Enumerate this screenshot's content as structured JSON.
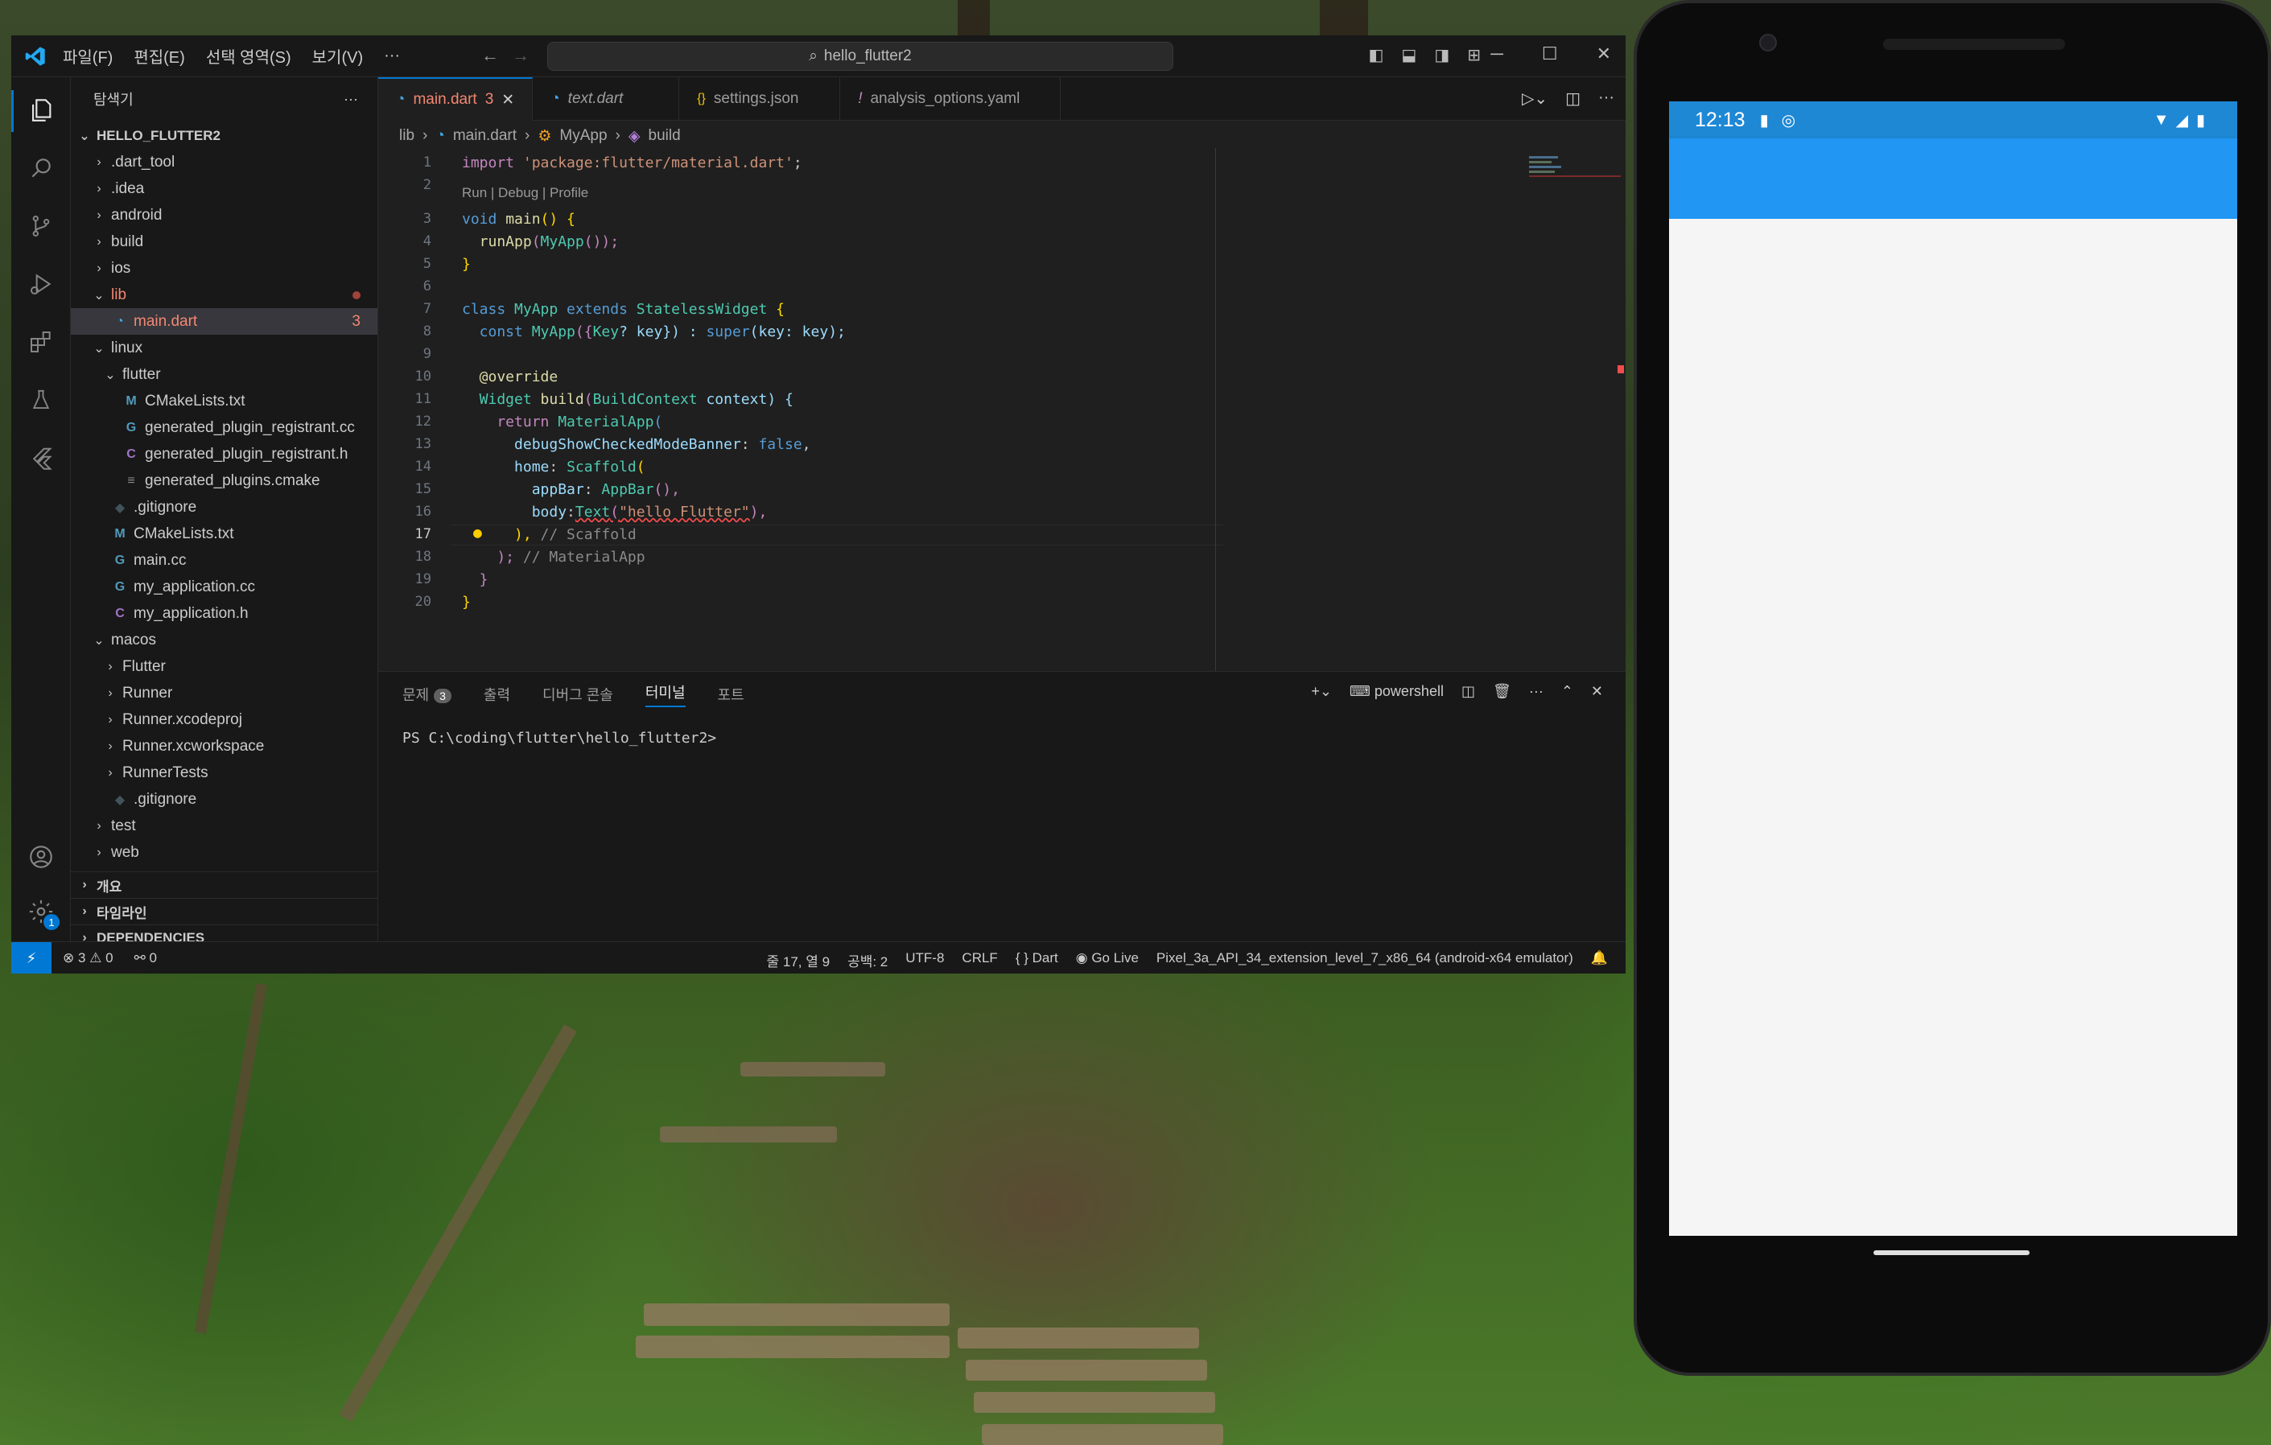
{
  "titlebar": {
    "menu": [
      "파일(F)",
      "편집(E)",
      "선택 영역(S)",
      "보기(V)",
      "···"
    ],
    "search": "hello_flutter2"
  },
  "sidebar": {
    "title": "탐색기",
    "more": "···",
    "root": "HELLO_FLUTTER2",
    "items": [
      {
        "label": ".dart_tool",
        "chev": "›",
        "icon": ""
      },
      {
        "label": ".idea",
        "chev": "›",
        "icon": ""
      },
      {
        "label": "android",
        "chev": "›",
        "icon": ""
      },
      {
        "label": "build",
        "chev": "›",
        "icon": ""
      },
      {
        "label": "ios",
        "chev": "›",
        "icon": ""
      },
      {
        "label": "lib",
        "chev": "⌄",
        "icon": ""
      },
      {
        "label": "main.dart",
        "chev": "",
        "icon": "◔",
        "badge": "3"
      },
      {
        "label": "linux",
        "chev": "⌄",
        "icon": ""
      },
      {
        "label": "flutter",
        "chev": "⌄",
        "icon": ""
      },
      {
        "label": "CMakeLists.txt",
        "chev": "",
        "icon": "M"
      },
      {
        "label": "generated_plugin_registrant.cc",
        "chev": "",
        "icon": "G"
      },
      {
        "label": "generated_plugin_registrant.h",
        "chev": "",
        "icon": "C"
      },
      {
        "label": "generated_plugins.cmake",
        "chev": "",
        "icon": "≡"
      },
      {
        "label": ".gitignore",
        "chev": "",
        "icon": "◆"
      },
      {
        "label": "CMakeLists.txt",
        "chev": "",
        "icon": "M"
      },
      {
        "label": "main.cc",
        "chev": "",
        "icon": "G"
      },
      {
        "label": "my_application.cc",
        "chev": "",
        "icon": "G"
      },
      {
        "label": "my_application.h",
        "chev": "",
        "icon": "C"
      },
      {
        "label": "macos",
        "chev": "⌄",
        "icon": ""
      },
      {
        "label": "Flutter",
        "chev": "›",
        "icon": ""
      },
      {
        "label": "Runner",
        "chev": "›",
        "icon": ""
      },
      {
        "label": "Runner.xcodeproj",
        "chev": "›",
        "icon": ""
      },
      {
        "label": "Runner.xcworkspace",
        "chev": "›",
        "icon": ""
      },
      {
        "label": "RunnerTests",
        "chev": "›",
        "icon": ""
      },
      {
        "label": ".gitignore",
        "chev": "",
        "icon": "◆"
      },
      {
        "label": "test",
        "chev": "›",
        "icon": ""
      },
      {
        "label": "web",
        "chev": "›",
        "icon": ""
      }
    ],
    "sections": [
      "개요",
      "타임라인",
      "DEPENDENCIES"
    ]
  },
  "tabs": [
    {
      "label": "main.dart",
      "badge": "3",
      "active": true
    },
    {
      "label": "text.dart"
    },
    {
      "label": "settings.json",
      "icon": "{}"
    },
    {
      "label": "analysis_options.yaml",
      "icon": "!"
    }
  ],
  "breadcrumb": {
    "lib": "lib",
    "file": "main.dart",
    "cls": "MyApp",
    "method": "build"
  },
  "code": {
    "codelens": "Run | Debug | Profile",
    "line_numbers": [
      "1",
      "2",
      "3",
      "4",
      "5",
      "6",
      "7",
      "8",
      "9",
      "10",
      "11",
      "12",
      "13",
      "14",
      "15",
      "16",
      "17",
      "18",
      "19",
      "20"
    ],
    "lines": {
      "l1": {
        "a": "import",
        "b": " 'package:flutter/material.dart'",
        "c": ";"
      },
      "l3": {
        "a": "void",
        "b": " main",
        "c": "() {"
      },
      "l4": {
        "a": "  runApp",
        "b": "(",
        "c": "MyApp",
        "d": "());"
      },
      "l5": "}",
      "l7": {
        "a": "class",
        "b": " MyApp",
        "c": " extends",
        "d": " StatelessWidget",
        "e": " {"
      },
      "l8": {
        "a": "  const",
        "b": " MyApp",
        "c": "({",
        "d": "Key",
        "e": "? key}) : ",
        "f": "super",
        "g": "(key: key);"
      },
      "l10": "  @override",
      "l11": {
        "a": "  Widget",
        "b": " build",
        "c": "(",
        "d": "BuildContext",
        "e": " context) {"
      },
      "l12": {
        "a": "    return",
        "b": " MaterialApp",
        "c": "("
      },
      "l13": {
        "a": "      debugShowCheckedModeBanner",
        "b": ": ",
        "c": "false",
        "d": ","
      },
      "l14": {
        "a": "      home",
        "b": ": ",
        "c": "Scaffold",
        "d": "("
      },
      "l15": {
        "a": "        appBar",
        "b": ": ",
        "c": "AppBar",
        "d": "(),"
      },
      "l16": {
        "a": "        body",
        "b": ":",
        "c": "Text",
        "d": "(",
        "e": "\"hello Flutter\"",
        "f": "),"
      },
      "l17": {
        "a": "      ), ",
        "b": "// Scaffold"
      },
      "l18": {
        "a": "    ); ",
        "b": "// MaterialApp"
      },
      "l19": "  }",
      "l20": "}"
    }
  },
  "panel": {
    "tabs": [
      "문제",
      "출력",
      "디버그 콘솔",
      "터미널",
      "포트"
    ],
    "problems_badge": "3",
    "shell": "powershell",
    "prompt": "PS C:\\coding\\flutter\\hello_flutter2>"
  },
  "statusbar": {
    "errors": "⊗ 3",
    "warnings": "⚠ 0",
    "ports": "⚯ 0",
    "position": "줄 17, 열 9",
    "spaces": "공백: 2",
    "encoding": "UTF-8",
    "eol": "CRLF",
    "language": "{ } Dart",
    "golive": "Go Live",
    "device": "Pixel_3a_API_34_extension_level_7_x86_64 (android-x64 emulator)"
  },
  "settings_badge": "1",
  "phone": {
    "time": "12:13"
  },
  "colors": {
    "accent": "#0078d4",
    "appbar": "#2196f3",
    "error": "#f14c4c"
  }
}
